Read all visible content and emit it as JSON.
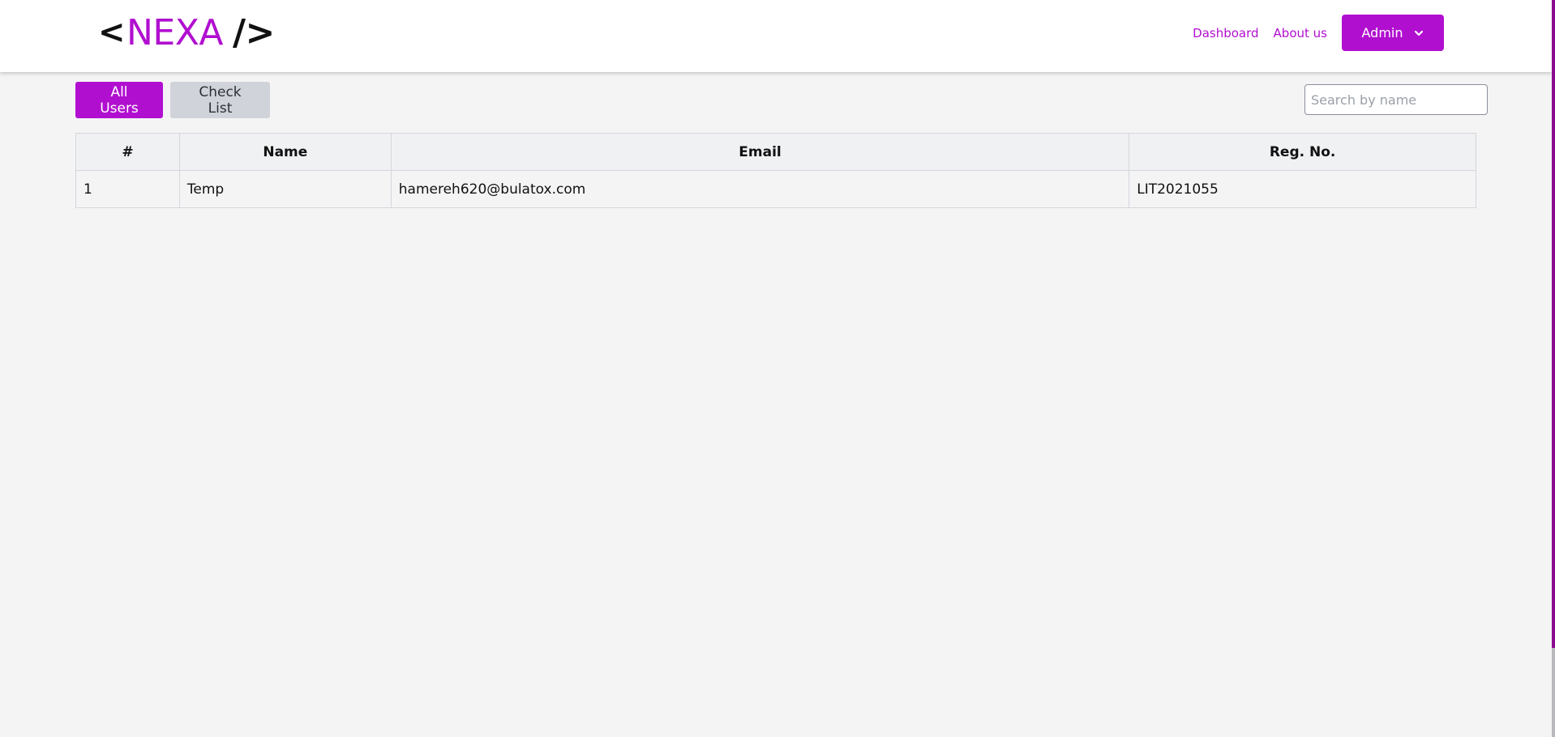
{
  "header": {
    "logo": {
      "open_bracket": "<",
      "brand": "NEXA",
      "close_tag": "/>"
    },
    "nav": {
      "dashboard": "Dashboard",
      "about": "About us",
      "admin_label": "Admin",
      "admin_icon": "chevron-down-icon"
    }
  },
  "toolbar": {
    "all_users_label": "All Users",
    "check_list_label": "Check List",
    "search_placeholder": "Search by name",
    "search_value": ""
  },
  "table": {
    "headers": [
      "#",
      "Name",
      "Email",
      "Reg. No."
    ],
    "rows": [
      [
        "1",
        "Temp",
        "hamereh620@bulatox.com",
        "LIT2021055"
      ]
    ]
  },
  "colors": {
    "accent": "#b10fd0",
    "secondary_button": "#d1d3da",
    "background": "#f4f4f5"
  }
}
